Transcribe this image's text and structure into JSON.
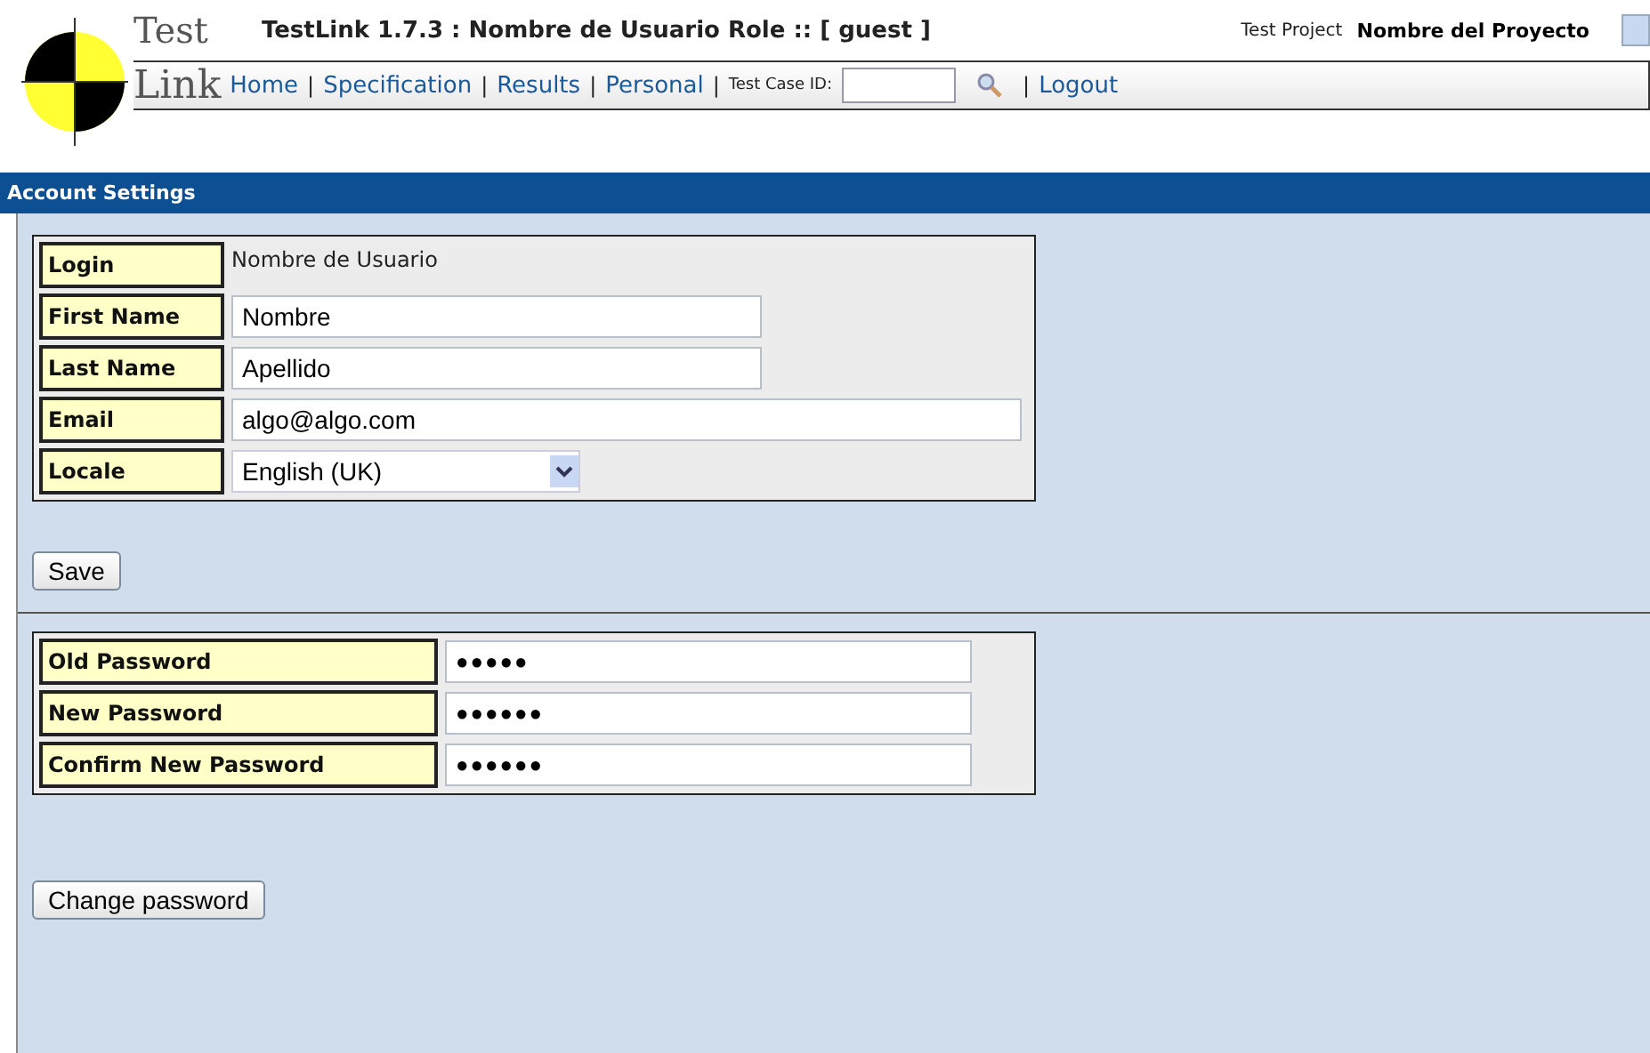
{
  "logo": {
    "top": "Test",
    "bottom": "Link"
  },
  "header": {
    "title": "TestLink 1.7.3 : Nombre de Usuario Role :: [ guest ]",
    "project_label": "Test Project",
    "project_name": "Nombre del Proyecto"
  },
  "nav": {
    "links": [
      "Home",
      "Specification",
      "Results",
      "Personal"
    ],
    "separator": "|",
    "test_case_label": "Test Case ID:",
    "logout": "Logout"
  },
  "section_title": "Account Settings",
  "account_fields": [
    {
      "label": "Login",
      "kind": "text",
      "value": "Nombre de Usuario"
    },
    {
      "label": "First Name",
      "kind": "input",
      "value": "Nombre"
    },
    {
      "label": "Last Name",
      "kind": "input",
      "value": "Apellido"
    },
    {
      "label": "Email",
      "kind": "wide",
      "value": "algo@algo.com"
    },
    {
      "label": "Locale",
      "kind": "select",
      "value": "English (UK)"
    }
  ],
  "save_button": "Save",
  "password_fields": [
    {
      "label": "Old Password",
      "value": "●●●●●"
    },
    {
      "label": "New Password",
      "value": "●●●●●●"
    },
    {
      "label": "Confirm New Password",
      "value": "●●●●●●"
    }
  ],
  "change_button": "Change password"
}
